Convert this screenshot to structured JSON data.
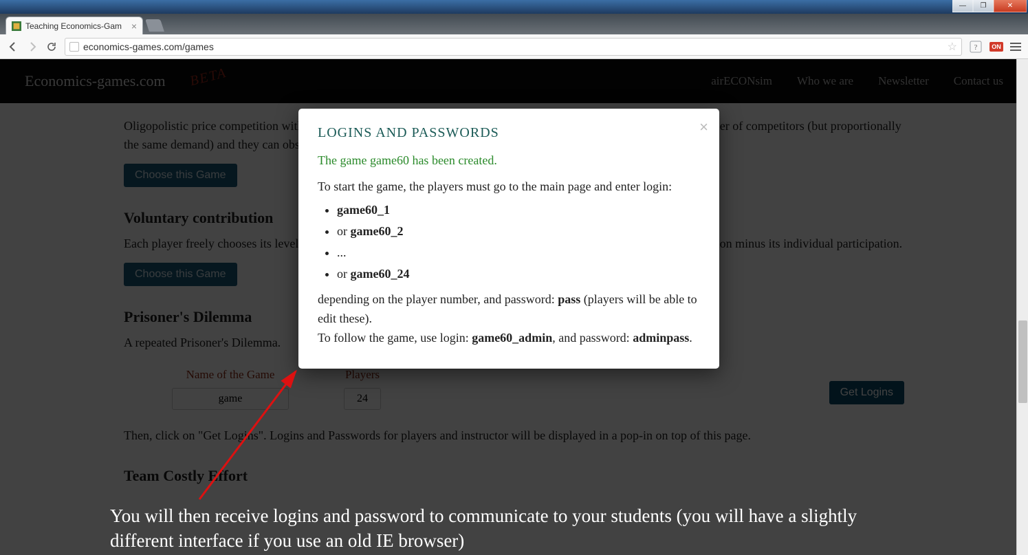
{
  "window": {
    "tab_title": "Teaching Economics-Gam",
    "url": "economics-games.com/games"
  },
  "nav": {
    "brand": "Economics-games.com",
    "beta": "BETA",
    "links": [
      "airECONsim",
      "Who we are",
      "Newsletter",
      "Contact us"
    ]
  },
  "page": {
    "oligopoly_desc": "Oligopolistic price competition with differentiated products. Players are firms in different markets with a different number of competitors (but proportionally the same demand) and they can observe the effect of competition intensity.",
    "choose_label": "Choose this Game",
    "voluntary_title": "Voluntary contribution",
    "voluntary_desc": "Each player freely chooses its level of participation in the common project. Gain is equal to twice the average participation minus its individual participation.",
    "prisoner_title": "Prisoner's Dilemma",
    "prisoner_desc": "A repeated Prisoner's Dilemma.",
    "name_label": "Name of the Game",
    "name_value": "game",
    "players_label": "Players",
    "players_value": "24",
    "get_logins": "Get Logins",
    "popin_note": "Then, click on \"Get Logins\". Logins and Passwords for players and instructor will be displayed in a pop-in on top of this page.",
    "team_title": "Team Costly Effort"
  },
  "modal": {
    "title": "LOGINS AND PASSWORDS",
    "created": "The game game60 has been created.",
    "intro": "To start the game, the players must go to the main page and enter login:",
    "logins": [
      "game60_1",
      "or game60_2",
      "...",
      "or game60_24"
    ],
    "depending_a": "depending on the player number, and password: ",
    "depending_pass": "pass",
    "depending_b": " (players will be able to edit these).",
    "follow_a": "To follow the game, use login: ",
    "follow_login": "game60_admin",
    "follow_b": ", and password: ",
    "follow_pass": "adminpass",
    "follow_c": "."
  },
  "caption": "You will then receive logins and password to communicate to your students (you will have a slightly different interface if you use an old IE browser)"
}
